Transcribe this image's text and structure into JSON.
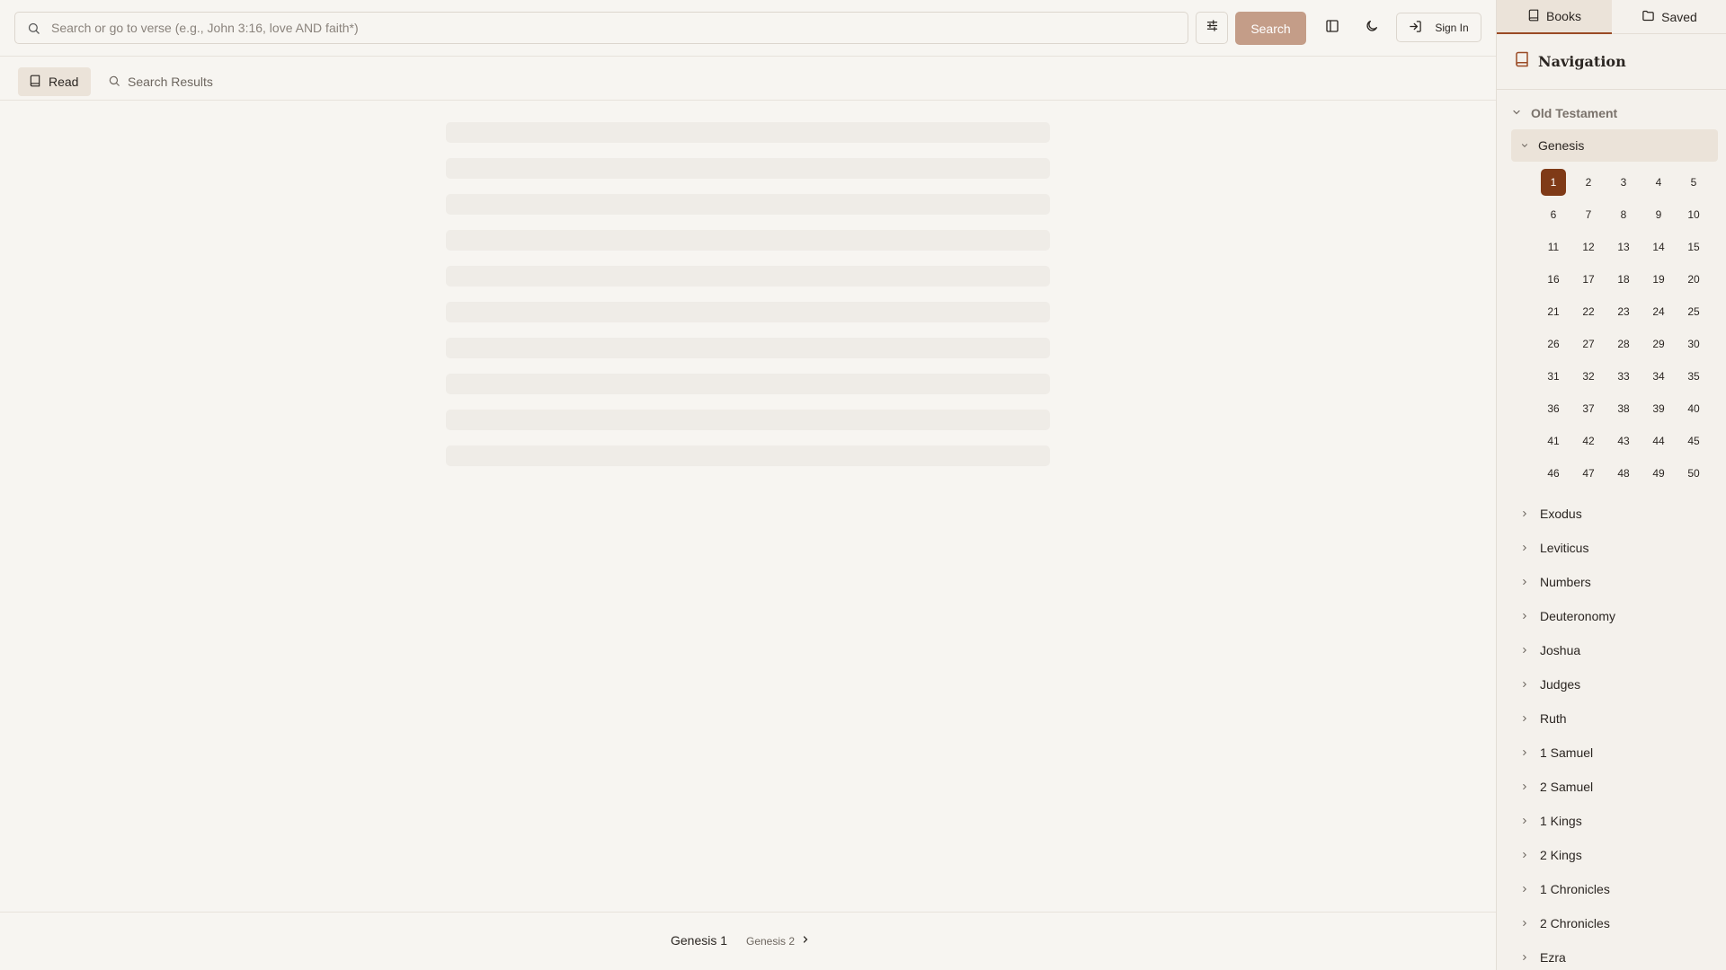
{
  "search": {
    "placeholder": "Search or go to verse (e.g., John 3:16, love AND faith*)",
    "value": "",
    "button_label": "Search"
  },
  "header": {
    "signin_label": "Sign In"
  },
  "tabs": [
    {
      "label": "Read",
      "active": true
    },
    {
      "label": "Search Results",
      "active": false
    }
  ],
  "footer": {
    "current": "Genesis 1",
    "next": "Genesis 2"
  },
  "sidebar": {
    "tabs": [
      {
        "label": "Books",
        "active": true
      },
      {
        "label": "Saved",
        "active": false
      }
    ],
    "title": "Navigation",
    "testament": "Old Testament",
    "expanded_book": "Genesis",
    "chapters": [
      "1",
      "2",
      "3",
      "4",
      "5",
      "6",
      "7",
      "8",
      "9",
      "10",
      "11",
      "12",
      "13",
      "14",
      "15",
      "16",
      "17",
      "18",
      "19",
      "20",
      "21",
      "22",
      "23",
      "24",
      "25",
      "26",
      "27",
      "28",
      "29",
      "30",
      "31",
      "32",
      "33",
      "34",
      "35",
      "36",
      "37",
      "38",
      "39",
      "40",
      "41",
      "42",
      "43",
      "44",
      "45",
      "46",
      "47",
      "48",
      "49",
      "50"
    ],
    "selected_chapter": "1",
    "books": [
      "Exodus",
      "Leviticus",
      "Numbers",
      "Deuteronomy",
      "Joshua",
      "Judges",
      "Ruth",
      "1 Samuel",
      "2 Samuel",
      "1 Kings",
      "2 Kings",
      "1 Chronicles",
      "2 Chronicles",
      "Ezra"
    ]
  },
  "colors": {
    "accent": "#7f3a17",
    "search_button": "#c49d88",
    "background": "#f7f5f1"
  }
}
